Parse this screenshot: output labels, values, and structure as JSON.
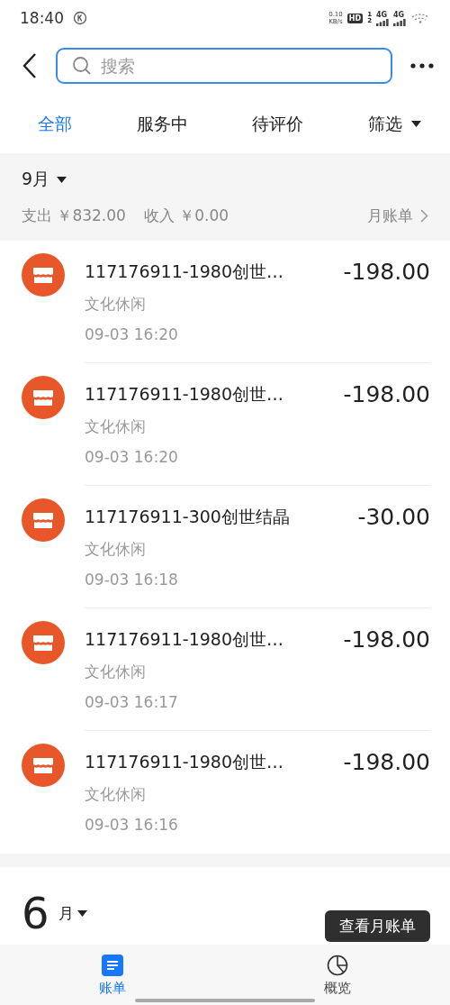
{
  "status_bar": {
    "time": "18:40",
    "speed_value": "0.10",
    "speed_unit": "KB/s",
    "hd": "HD",
    "sim_1": "1",
    "sim_2": "2",
    "networks": [
      "4G",
      "4G"
    ]
  },
  "search": {
    "placeholder": "搜索"
  },
  "tabs": [
    {
      "label": "全部",
      "selected": true
    },
    {
      "label": "服务中",
      "selected": false
    },
    {
      "label": "待评价",
      "selected": false
    }
  ],
  "filter": {
    "label": "筛选"
  },
  "month": {
    "label": "9月",
    "expense": "支出 ￥832.00",
    "income": "收入 ￥0.00",
    "bill_link": "月账单"
  },
  "transactions": [
    {
      "title": "117176911-1980创世…",
      "category": "文化休闲",
      "time": "09-03  16:20",
      "amount": "-198.00"
    },
    {
      "title": "117176911-1980创世…",
      "category": "文化休闲",
      "time": "09-03  16:20",
      "amount": "-198.00"
    },
    {
      "title": "117176911-300创世结晶",
      "category": "文化休闲",
      "time": "09-03  16:18",
      "amount": "-30.00"
    },
    {
      "title": "117176911-1980创世…",
      "category": "文化休闲",
      "time": "09-03  16:17",
      "amount": "-198.00"
    },
    {
      "title": "117176911-1980创世…",
      "category": "文化休闲",
      "time": "09-03  16:16",
      "amount": "-198.00"
    }
  ],
  "next_month": {
    "number": "6",
    "unit": "月",
    "button": "查看月账单"
  },
  "bottom_nav": [
    {
      "label": "账单",
      "kind": "list",
      "selected": true
    },
    {
      "label": "概览",
      "kind": "pie",
      "selected": false
    }
  ]
}
